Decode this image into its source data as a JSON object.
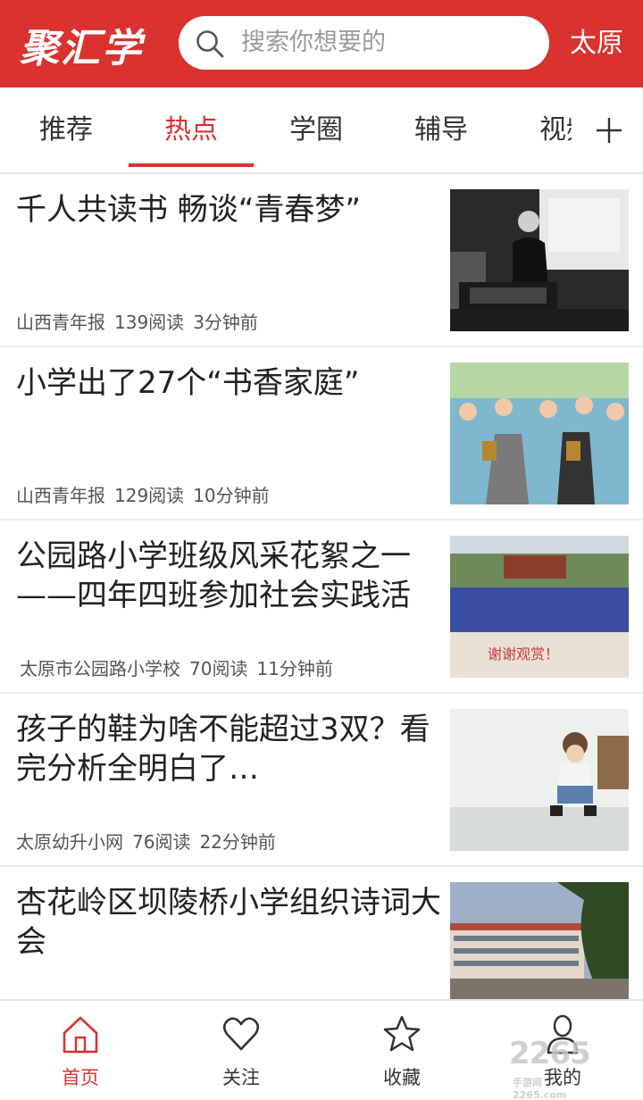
{
  "header": {
    "logo": "聚汇学",
    "search_placeholder": "搜索你想要的",
    "city": "太原",
    "brand_color": "#d9322f"
  },
  "tabs": [
    {
      "label": "推荐",
      "active": false
    },
    {
      "label": "热点",
      "active": true
    },
    {
      "label": "学圈",
      "active": false
    },
    {
      "label": "辅导",
      "active": false
    },
    {
      "label": "视频",
      "active": false
    }
  ],
  "tabs_more_icon": "plus-icon",
  "feed": [
    {
      "title": "千人共读书 畅谈“青春梦”",
      "source": "山西青年报",
      "reads": "139阅读",
      "time": "3分钟前",
      "thumb": "speaker-at-podium-photo"
    },
    {
      "title": "小学出了27个“书香家庭”",
      "source": "山西青年报",
      "reads": "129阅读",
      "time": "10分钟前",
      "thumb": "children-costume-performance-photo"
    },
    {
      "title": "公园路小学班级风采花絮之一——四年四班参加社会实践活",
      "source": "太原市公园路小学校",
      "reads": "70阅读",
      "time": "11分钟前",
      "thumb": "class-group-photo",
      "thumb_caption": "谢谢观赏！"
    },
    {
      "title": "孩子的鞋为啥不能超过3双？看完分析全明白了…",
      "source": "太原幼升小网",
      "reads": "76阅读",
      "time": "22分钟前",
      "thumb": "child-tying-shoes-photo"
    },
    {
      "title": "杏花岭区坝陵桥小学组织诗词大会",
      "source": "",
      "reads": "",
      "time": "",
      "thumb": "school-building-photo"
    }
  ],
  "bottom_nav": [
    {
      "label": "首页",
      "icon": "home-icon",
      "active": true
    },
    {
      "label": "关注",
      "icon": "heart-icon",
      "active": false
    },
    {
      "label": "收藏",
      "icon": "star-icon",
      "active": false
    },
    {
      "label": "我的",
      "icon": "user-icon",
      "active": false
    }
  ],
  "watermark": {
    "text": "2265",
    "sub1": "手游网",
    "sub2": "2265.com"
  }
}
